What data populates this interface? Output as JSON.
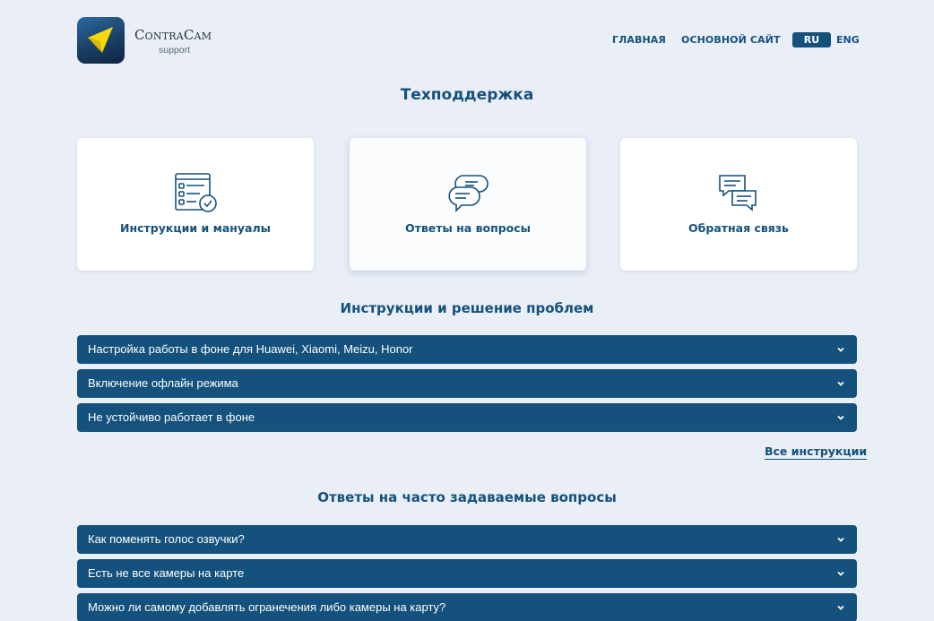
{
  "header": {
    "logo_title": "ContraCam",
    "logo_subtitle": "support",
    "nav": [
      {
        "label": "ГЛАВНАЯ"
      },
      {
        "label": "ОСНОВНОЙ САЙТ"
      }
    ],
    "lang_active": "RU",
    "lang_other": "ENG"
  },
  "page_title": "Техподдержка",
  "cards": [
    {
      "label": "Инструкции и мануалы",
      "icon": "checklist-icon"
    },
    {
      "label": "Ответы на вопросы",
      "icon": "chat-bubbles-icon"
    },
    {
      "label": "Обратная связь",
      "icon": "feedback-icon"
    }
  ],
  "instructions": {
    "title": "Инструкции и решение проблем",
    "items": [
      {
        "label": "Настройка работы в фоне для Huawei, Xiaomi, Meizu, Honor"
      },
      {
        "label": "Включение офлайн режима"
      },
      {
        "label": "Не устойчиво работает в фоне"
      }
    ],
    "all_link": "Все инструкции"
  },
  "faq": {
    "title": "Ответы на часто задаваемые вопросы",
    "items": [
      {
        "label": "Как поменять голос озвучки?"
      },
      {
        "label": "Есть не все камеры на карте"
      },
      {
        "label": "Можно ли самому добавлять огранечения либо камеры на карту?"
      }
    ]
  },
  "colors": {
    "background": "#e9eef7",
    "primary": "#14517c",
    "card": "#ffffff",
    "logo_accent": "#f5d90a"
  }
}
